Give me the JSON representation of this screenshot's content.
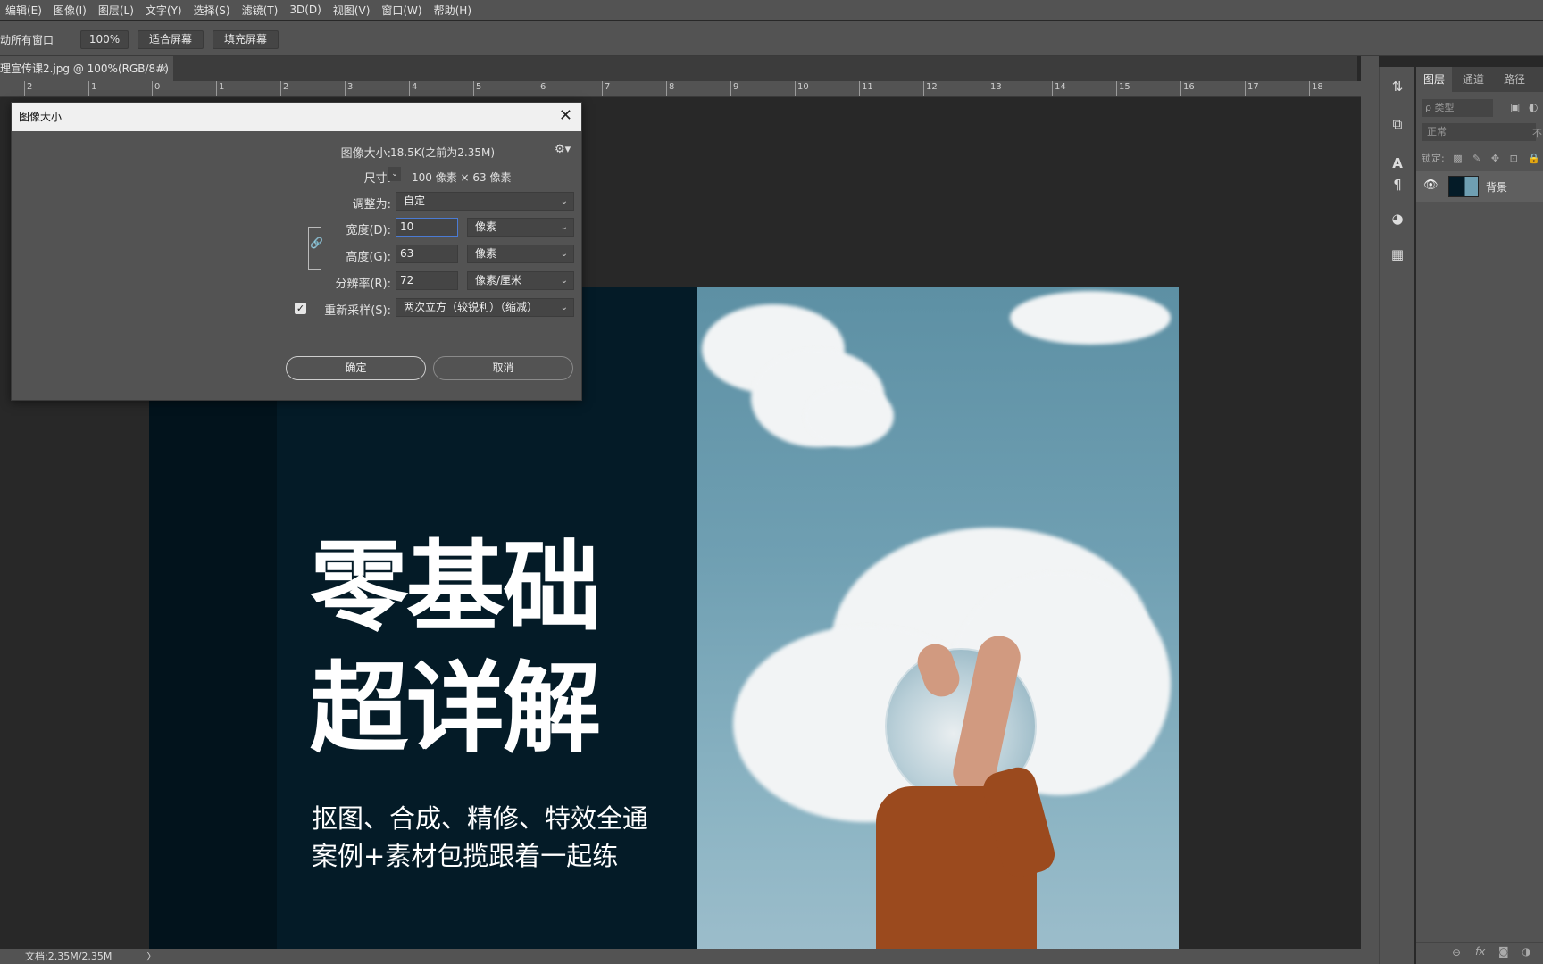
{
  "menu": [
    "编辑(E)",
    "图像(I)",
    "图层(L)",
    "文字(Y)",
    "选择(S)",
    "滤镜(T)",
    "3D(D)",
    "视图(V)",
    "窗口(W)",
    "帮助(H)"
  ],
  "options": {
    "scroll_all_label": "滚动所有窗口",
    "zoom_100": "100%",
    "fit_screen": "适合屏幕",
    "fill_screen": "填充屏幕"
  },
  "doc_tab": {
    "title": "理宣传课2.jpg @ 100%(RGB/8#)",
    "close": "×"
  },
  "ruler": {
    "ticks": [
      "2",
      "1",
      "0",
      "1",
      "2",
      "3",
      "4",
      "5",
      "6",
      "7",
      "8",
      "9",
      "10",
      "11",
      "12",
      "13",
      "14",
      "15",
      "16",
      "17",
      "18"
    ]
  },
  "image_text": {
    "line1": "零基础",
    "line2": "超详解",
    "sub1": "抠图、合成、精修、特效全通",
    "sub2": "案例+素材包揽跟着一起练"
  },
  "dialog": {
    "title": "图像大小",
    "close": "✕",
    "image_size_label": "图像大小:",
    "image_size_value": "18.5K(之前为2.35M)",
    "dimensions_label": "尺寸:",
    "dimensions_value": "100 像素  ×  63 像素",
    "fit_to_label": "调整为:",
    "fit_to_value": "自定",
    "width_label": "宽度(D):",
    "width_value": "10",
    "width_unit": "像素",
    "height_label": "高度(G):",
    "height_value": "63",
    "height_unit": "像素",
    "resolution_label": "分辨率(R):",
    "resolution_value": "72",
    "resolution_unit": "像素/厘米",
    "resample_label": "重新采样(S):",
    "resample_checked": true,
    "resample_value": "两次立方（较锐利）（缩减）",
    "ok": "确定",
    "cancel": "取消"
  },
  "status": {
    "doc_info": "文档:2.35M/2.35M",
    "arrow": "〉"
  },
  "layers_panel": {
    "tabs": [
      "图层",
      "通道",
      "路径"
    ],
    "filter_placeholder": "ρ 类型",
    "blend_mode": "正常",
    "opacity_label": "不",
    "lock_label": "锁定:",
    "layer_name": "背景"
  }
}
